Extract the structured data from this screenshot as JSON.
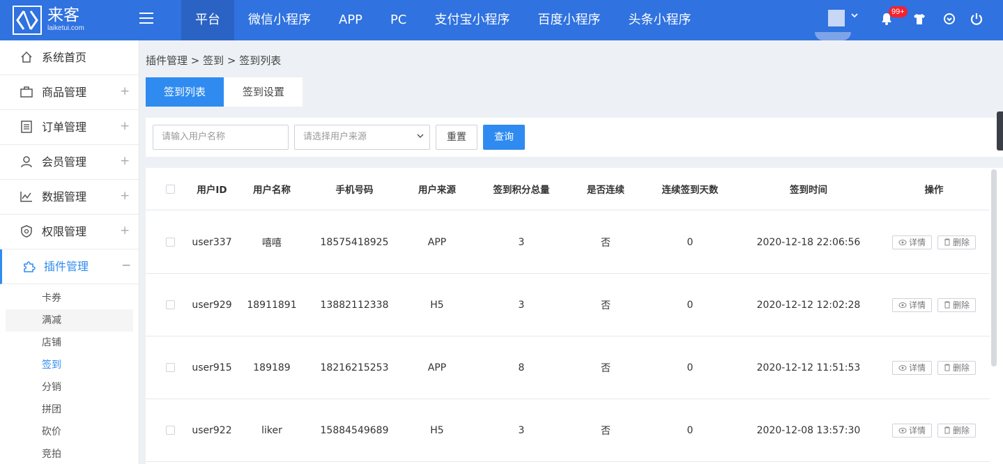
{
  "brand": {
    "name": "来客",
    "sub": "laiketui.com"
  },
  "nav": [
    {
      "label": "平台",
      "active": true
    },
    {
      "label": "微信小程序"
    },
    {
      "label": "APP"
    },
    {
      "label": "PC"
    },
    {
      "label": "支付宝小程序"
    },
    {
      "label": "百度小程序"
    },
    {
      "label": "头条小程序"
    }
  ],
  "header": {
    "badge": "99+"
  },
  "sidebar": {
    "items": [
      {
        "label": "系统首页",
        "icon": "home-icon"
      },
      {
        "label": "商品管理",
        "icon": "briefcase-icon",
        "toggle": "+"
      },
      {
        "label": "订单管理",
        "icon": "order-list-icon",
        "toggle": "+"
      },
      {
        "label": "会员管理",
        "icon": "user-icon",
        "toggle": "+"
      },
      {
        "label": "数据管理",
        "icon": "chart-line-icon",
        "toggle": "+"
      },
      {
        "label": "权限管理",
        "icon": "shield-icon",
        "toggle": "+"
      },
      {
        "label": "插件管理",
        "icon": "puzzle-icon",
        "toggle": "−",
        "active": true
      }
    ],
    "subitems": [
      "卡券",
      "满减",
      "店铺",
      "签到",
      "分销",
      "拼团",
      "砍价",
      "竞拍"
    ]
  },
  "breadcrumb": "插件管理 > 签到 > 签到列表",
  "tabs": [
    "签到列表",
    "签到设置"
  ],
  "filter": {
    "username_placeholder": "请输入用户名称",
    "source_placeholder": "请选择用户来源",
    "reset_label": "重置",
    "query_label": "查询"
  },
  "table": {
    "columns": [
      "用户ID",
      "用户名称",
      "手机号码",
      "用户来源",
      "签到积分总量",
      "是否连续",
      "连续签到天数",
      "签到时间",
      "操作"
    ],
    "detail_label": "详情",
    "delete_label": "删除",
    "rows": [
      {
        "id": "user337",
        "name": "嘻嘻",
        "phone": "18575418925",
        "source": "APP",
        "points": "3",
        "continuous": "否",
        "days": "0",
        "time": "2020-12-18 22:06:56"
      },
      {
        "id": "user929",
        "name": "18911891",
        "phone": "13882112338",
        "source": "H5",
        "points": "3",
        "continuous": "否",
        "days": "0",
        "time": "2020-12-12 12:02:28"
      },
      {
        "id": "user915",
        "name": "189189",
        "phone": "18216215253",
        "source": "APP",
        "points": "8",
        "continuous": "否",
        "days": "0",
        "time": "2020-12-12 11:51:53"
      },
      {
        "id": "user922",
        "name": "liker",
        "phone": "15884549689",
        "source": "H5",
        "points": "3",
        "continuous": "否",
        "days": "0",
        "time": "2020-12-08 13:57:30"
      }
    ]
  }
}
